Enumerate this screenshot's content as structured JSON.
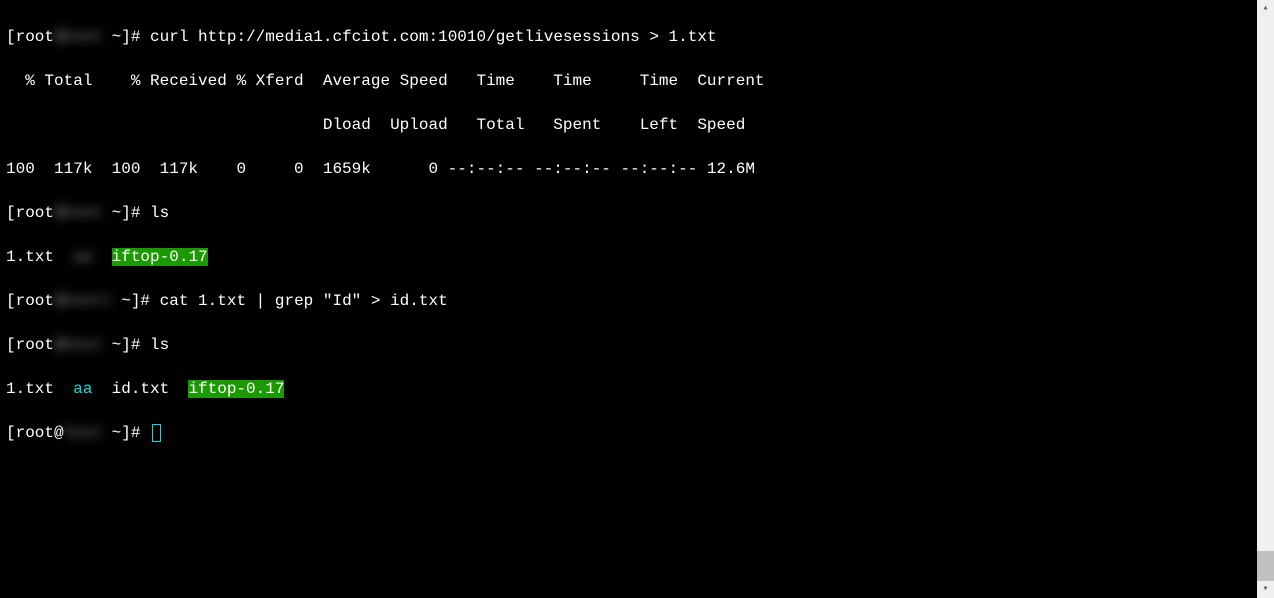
{
  "line1": {
    "prompt_start": "[root",
    "blur": "@host",
    "prompt_end": " ~]# ",
    "cmd": "curl http://media1.cfciot.com:10010/getlivesessions > 1.txt"
  },
  "header1": "  % Total    % Received % Xferd  Average Speed   Time    Time     Time  Current",
  "header2": "                                 Dload  Upload   Total   Spent    Left  Speed",
  "progress": "100  117k  100  117k    0     0  1659k      0 --:--:-- --:--:-- --:--:-- 12.6M",
  "line5": {
    "prompt_start": "[root",
    "blur": "@host",
    "prompt_end": " ~]# ",
    "cmd": "ls"
  },
  "ls1": {
    "f1": "1.txt  ",
    "f2": "aa",
    "f3": "  ",
    "f4": "iftop-0.17"
  },
  "line7": {
    "prompt_start": "[root",
    "blur": "@hostl",
    "prompt_end": " ~]# ",
    "cmd": "cat 1.txt | grep \"Id\" > id.txt"
  },
  "line8": {
    "prompt_start": "[root",
    "blur": "@host",
    "prompt_end": " ~]# ",
    "cmd": "ls"
  },
  "ls2": {
    "f1": "1.txt  ",
    "f2": "aa",
    "f3": "  id.txt  ",
    "f4": "iftop-0.17"
  },
  "line10": {
    "prompt_start": "[root@",
    "blur": "host",
    "prompt_end": " ~]# "
  },
  "scroll": {
    "up": "▴",
    "down": "▾"
  }
}
